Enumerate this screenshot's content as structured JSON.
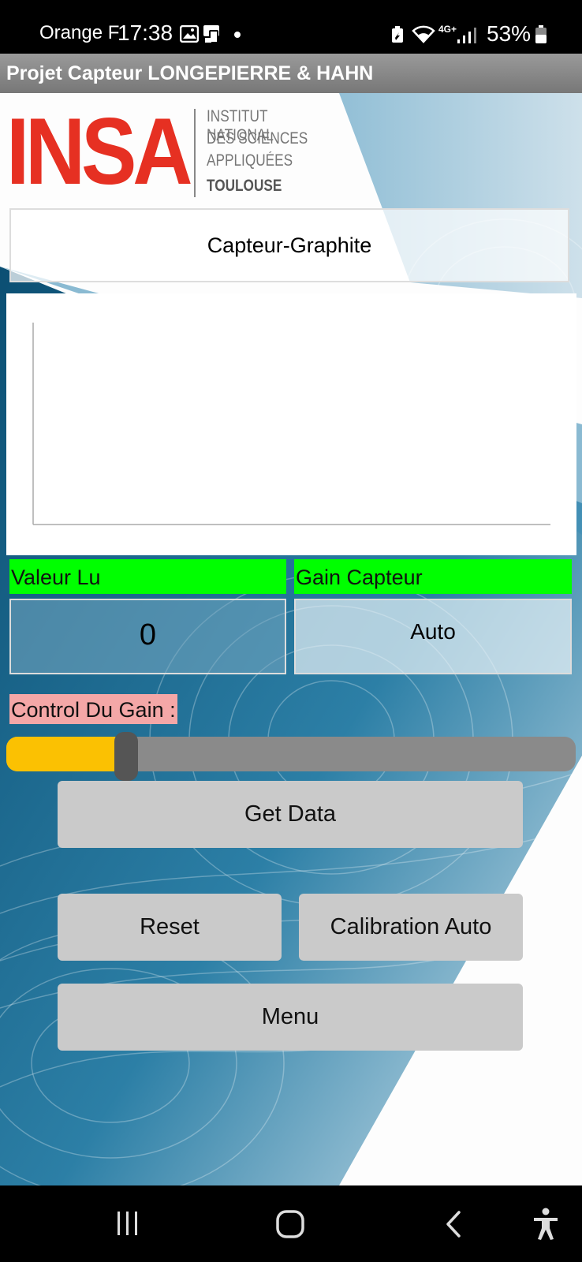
{
  "status_bar": {
    "carrier": "Orange F",
    "time": "17:38",
    "network": "4G+",
    "battery": "53%"
  },
  "app": {
    "title": "Projet Capteur LONGEPIERRE & HAHN"
  },
  "logo": {
    "name": "INSA",
    "lines": [
      "INSTITUT NATIONAL",
      "DES SCIENCES",
      "APPLIQUÉES",
      "TOULOUSE"
    ]
  },
  "device_name": "Capteur-Graphite",
  "readings": {
    "value_label": "Valeur Lu",
    "value": "0",
    "gain_label": "Gain Capteur",
    "gain_value": "Auto"
  },
  "gain_control": {
    "label": "Control Du Gain :",
    "level": 0.21
  },
  "buttons": {
    "get_data": "Get Data",
    "reset": "Reset",
    "calibration": "Calibration Auto",
    "menu": "Menu"
  },
  "colors": {
    "label_green": "#00ff00",
    "label_pink": "#f4a7a7",
    "slider_fill": "#fbc102",
    "insa_red": "#e63022",
    "background_blue": "#0d5a80"
  },
  "icons": {
    "status": [
      "gallery-icon",
      "cast-icon",
      "notification-dot-icon",
      "battery-saver-icon",
      "wifi-icon",
      "signal-icon",
      "battery-icon"
    ],
    "nav": [
      "recents-icon",
      "home-icon",
      "back-icon",
      "accessibility-icon"
    ]
  }
}
